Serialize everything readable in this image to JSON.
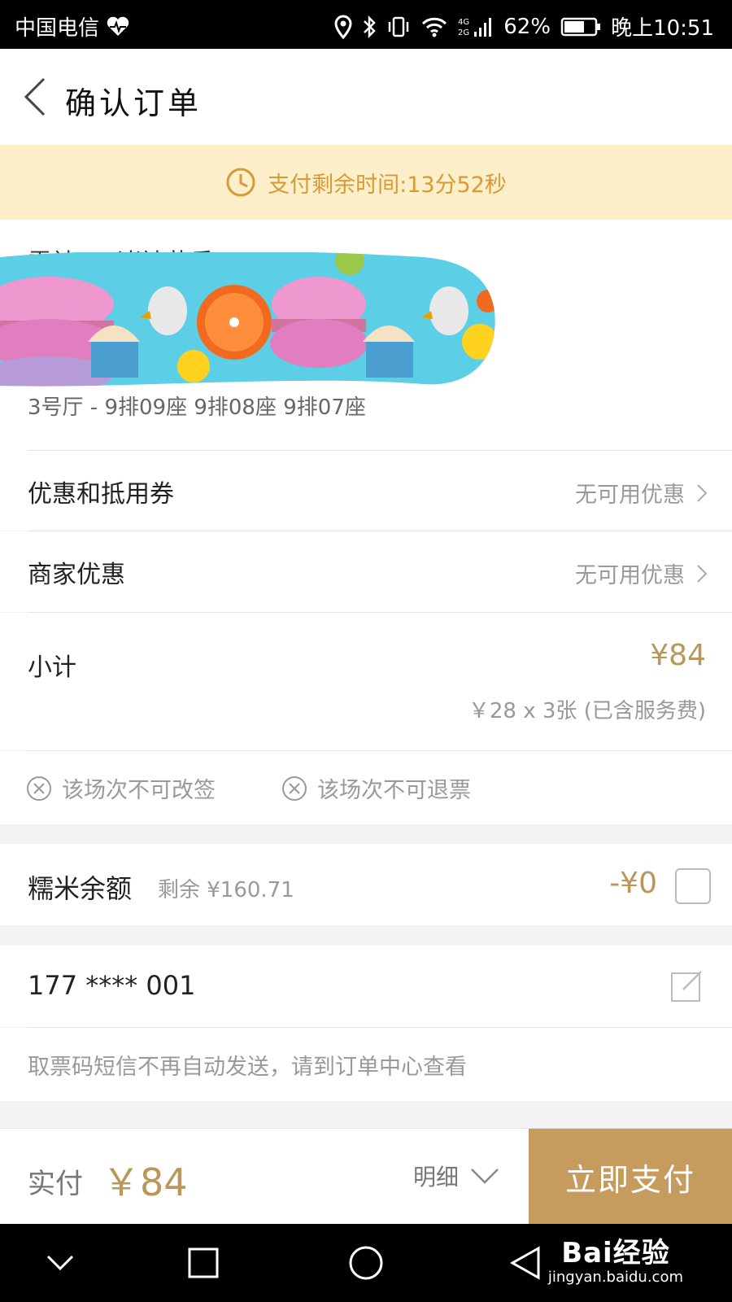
{
  "status_bar": {
    "carrier": "中国电信",
    "battery": "62%",
    "time": "晚上10:51",
    "network": "4G"
  },
  "header": {
    "title": "确认订单"
  },
  "countdown": {
    "text": "支付剩余时间:13分52秒"
  },
  "movie": {
    "title_partial": "雷神3：诸神黄昏",
    "seats": "3号厅 - 9排09座 9排08座 9排07座"
  },
  "coupons": {
    "label": "优惠和抵用券",
    "value": "无可用优惠"
  },
  "merchant": {
    "label": "商家优惠",
    "value": "无可用优惠"
  },
  "subtotal": {
    "label": "小计",
    "amount": "¥84",
    "detail": "￥28 x 3张 (已含服务费)"
  },
  "notices": {
    "no_change": "该场次不可改签",
    "no_refund": "该场次不可退票"
  },
  "balance": {
    "label": "糯米余额",
    "remaining": "剩余 ¥160.71",
    "deduction": "-¥0"
  },
  "phone": {
    "number": "177 **** 001",
    "hint": "取票码短信不再自动发送，请到订单中心查看"
  },
  "paybar": {
    "label": "实付",
    "amount": "￥84",
    "detail_label": "明细",
    "pay_button": "立即支付"
  },
  "watermark": {
    "logo": "Bai经验",
    "url": "jingyan.baidu.com"
  },
  "colors": {
    "gold": "#b9965a",
    "pay_button": "#c69c5e",
    "countdown_bg": "#fcefc9",
    "countdown_text": "#d99a35"
  }
}
